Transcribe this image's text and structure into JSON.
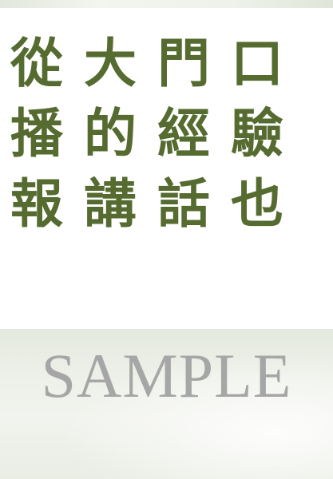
{
  "title": {
    "lines": [
      [
        "從",
        "大",
        "門",
        "口"
      ],
      [
        "播",
        "的",
        "經",
        "驗"
      ],
      [
        "報",
        "講",
        "話",
        "也"
      ]
    ]
  },
  "watermark": {
    "text": "SAMPLE"
  },
  "colors": {
    "title_text": "#556b2f",
    "watermark_text": "#a6a6a6",
    "background": "#ffffff",
    "panel": "#eef1ea"
  }
}
